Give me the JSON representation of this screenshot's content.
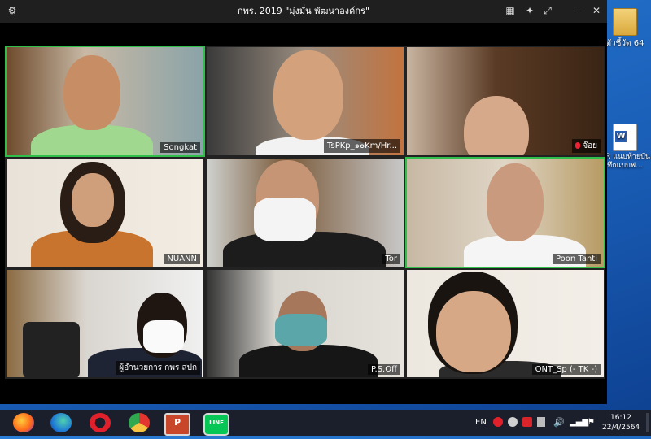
{
  "window": {
    "title": "กพร. 2019 \"มุ่งมั่น พัฒนาองค์กร\""
  },
  "participants": [
    {
      "name": "Songkat",
      "active": true,
      "muted": false
    },
    {
      "name": "TsPKp_๑๐Km/Hr...",
      "active": false,
      "muted": false
    },
    {
      "name": "จ๊อย",
      "active": false,
      "muted": true
    },
    {
      "name": "NUANN",
      "active": false,
      "muted": false
    },
    {
      "name": "Tor",
      "active": false,
      "muted": false
    },
    {
      "name": "Poon Tanti",
      "active": true,
      "muted": false
    },
    {
      "name": "ผู้อำนวยการ กพร สปก",
      "active": false,
      "muted": false
    },
    {
      "name": "P.S.Off",
      "active": false,
      "muted": false
    },
    {
      "name": "ONT_Sp (- TK -)",
      "active": false,
      "muted": false
    }
  ],
  "desktop": {
    "icons": [
      {
        "label": "ตัวชี้วัด 64"
      },
      {
        "label": "QR แนบท้ายบันทึกแบบฟ..."
      }
    ]
  },
  "taskbar": {
    "apps": [
      "firefox-icon",
      "edge-icon",
      "opera-icon",
      "chrome-icon",
      "powerpoint-icon",
      "line-icon"
    ],
    "language": "EN",
    "time": "16:12",
    "date": "22/4/2564"
  }
}
